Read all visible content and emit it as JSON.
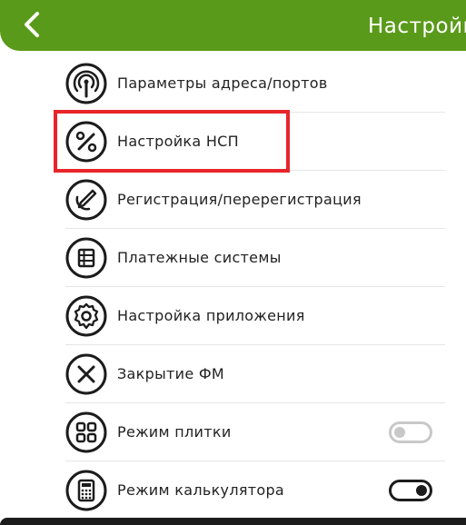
{
  "header": {
    "title": "Настройки",
    "background_color": "#5a9a1a",
    "back_icon": "chevron-left-icon"
  },
  "menu": {
    "items": [
      {
        "label": "Параметры адреса/портов",
        "icon": "antenna-icon"
      },
      {
        "label": "Настройка НСП",
        "icon": "percent-icon",
        "highlighted": true
      },
      {
        "label": "Регистрация/перерегистрация",
        "icon": "edit-icon"
      },
      {
        "label": "Платежные системы",
        "icon": "grid-list-icon"
      },
      {
        "label": "Настройка приложения",
        "icon": "gear-icon"
      },
      {
        "label": "Закрытие ФМ",
        "icon": "close-circle-icon"
      },
      {
        "label": "Режим плитки",
        "icon": "tiles-icon",
        "toggle": "off"
      },
      {
        "label": "Режим калькулятора",
        "icon": "calculator-icon",
        "toggle": "on"
      }
    ]
  },
  "colors": {
    "accent": "#5a9a1a",
    "highlight_border": "#e8252a",
    "icon_stroke": "#1c1c1c"
  }
}
